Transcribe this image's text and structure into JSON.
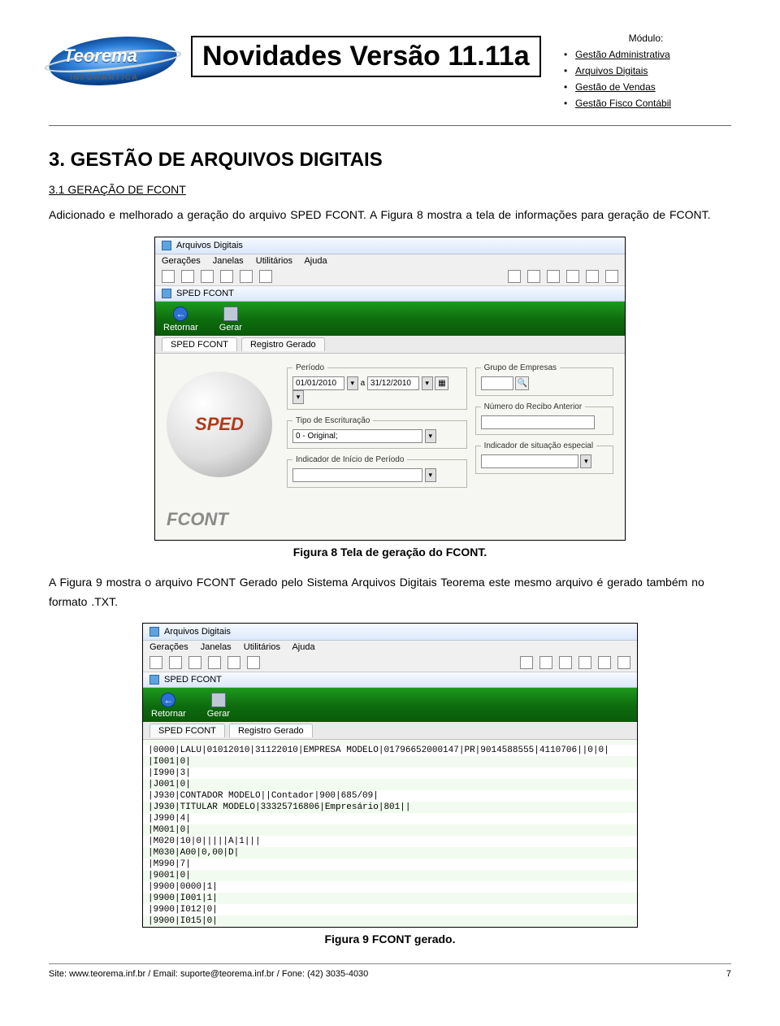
{
  "header": {
    "logo_name": "Teorema",
    "logo_sub": "INFORMÁTICA",
    "title": "Novidades Versão 11.11a",
    "module_label": "Módulo:",
    "modules": [
      "Gestão Administrativa",
      "Arquivos Digitais",
      "Gestão de Vendas",
      "Gestão Fisco Contábil"
    ]
  },
  "section": {
    "title": "3. GESTÃO DE ARQUIVOS DIGITAIS",
    "sub": "3.1 GERAÇÃO DE FCONT",
    "p1": "Adicionado e melhorado a geração do arquivo SPED FCONT. A Figura 8 mostra a tela de informações para geração de FCONT.",
    "p2": "A Figura 9 mostra o arquivo FCONT Gerado pelo Sistema Arquivos Digitais Teorema este mesmo arquivo é gerado também no formato .TXT."
  },
  "fig8": {
    "caption": "Figura 8 Tela de geração do FCONT.",
    "window_title": "Arquivos Digitais",
    "menus": [
      "Gerações",
      "Janelas",
      "Utilitários",
      "Ajuda"
    ],
    "subwindow_title": "SPED FCONT",
    "green_back": "Retornar",
    "green_gen": "Gerar",
    "tab1": "SPED FCONT",
    "tab2": "Registro Gerado",
    "sped_label": "SPED",
    "fcont_label": "FCONT",
    "fs_periodo": "Período",
    "periodo_ini": "01/01/2010",
    "periodo_sep": "a",
    "periodo_fim": "31/12/2010",
    "fs_tipo": "Tipo de Escrituração",
    "tipo_val": "0 - Original;",
    "fs_indicador": "Indicador de Início de Período",
    "fs_grupo": "Grupo de Empresas",
    "fs_recibo": "Número do Recibo Anterior",
    "fs_situacao": "Indicador de situação especial"
  },
  "fig9": {
    "caption": "Figura 9 FCONT gerado.",
    "window_title": "Arquivos Digitais",
    "menus": [
      "Gerações",
      "Janelas",
      "Utilitários",
      "Ajuda"
    ],
    "subwindow_title": "SPED FCONT",
    "green_back": "Retornar",
    "green_gen": "Gerar",
    "tab1": "SPED FCONT",
    "tab2": "Registro Gerado",
    "lines": [
      "|0000|LALU|01012010|31122010|EMPRESA MODELO|01796652000147|PR|9014588555|4110706||0|0|",
      "|I001|0|",
      "|I990|3|",
      "|J001|0|",
      "|J930|CONTADOR MODELO||Contador|900|685/09|",
      "|J930|TITULAR MODELO|33325716806|Empresário|801||",
      "|J990|4|",
      "|M001|0|",
      "|M020|10|0|||||A|1|||",
      "|M030|A00|0,00|D|",
      "|M990|7|",
      "|9001|0|",
      "|9900|0000|1|",
      "|9900|I001|1|",
      "|9900|I012|0|",
      "|9900|I015|0|"
    ]
  },
  "footer": {
    "left": "Site: www.teorema.inf.br / Email: suporte@teorema.inf.br / Fone: (42) 3035-4030",
    "page": "7"
  }
}
